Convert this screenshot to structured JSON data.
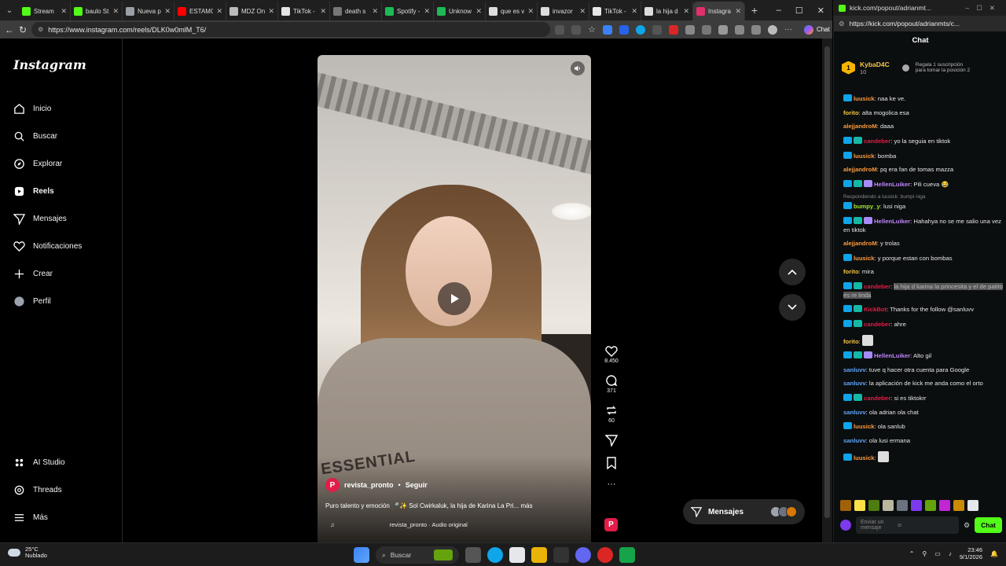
{
  "browser": {
    "tabs": [
      {
        "label": "Stream",
        "color": "#53fc18"
      },
      {
        "label": "baulo St",
        "color": "#53fc18"
      },
      {
        "label": "Nueva p",
        "color": "#9aa0a6"
      },
      {
        "label": "ESTAMO",
        "color": "#ff0000"
      },
      {
        "label": "MDZ On",
        "color": "#bbbbbb"
      },
      {
        "label": "TikTok -",
        "color": "#e6e6e6"
      },
      {
        "label": "death s",
        "color": "#777777"
      },
      {
        "label": "Spotify -",
        "color": "#1db954"
      },
      {
        "label": "Unknow",
        "color": "#1db954"
      },
      {
        "label": "que es v",
        "color": "#dddddd"
      },
      {
        "label": "invazor",
        "color": "#dddddd"
      },
      {
        "label": "TikTok -",
        "color": "#e6e6e6"
      },
      {
        "label": "la hija d",
        "color": "#dddddd"
      },
      {
        "label": "Instagra",
        "color": "#e1306c",
        "active": true
      }
    ],
    "url": "https://www.instagram.com/reels/DLK0w0mlM_T6/",
    "chat_button": "Chat"
  },
  "instagram": {
    "logo": "Instagram",
    "nav": [
      {
        "label": "Inicio",
        "icon": "home-icon"
      },
      {
        "label": "Buscar",
        "icon": "search-icon"
      },
      {
        "label": "Explorar",
        "icon": "compass-icon"
      },
      {
        "label": "Reels",
        "icon": "reels-icon",
        "active": true
      },
      {
        "label": "Mensajes",
        "icon": "send-icon"
      },
      {
        "label": "Notificaciones",
        "icon": "heart-icon"
      },
      {
        "label": "Crear",
        "icon": "plus-icon"
      },
      {
        "label": "Perfil",
        "icon": "avatar-icon"
      }
    ],
    "bottom_nav": [
      {
        "label": "AI Studio",
        "icon": "ai-studio-icon"
      },
      {
        "label": "Threads",
        "icon": "threads-icon"
      },
      {
        "label": "Más",
        "icon": "menu-icon"
      }
    ],
    "reel": {
      "shirt_text": "ESSENTIAL",
      "author": "revista_pronto",
      "author_initial": "P",
      "separator": "•",
      "follow": "Seguir",
      "caption": "Puro talento y emoción 🎤✨ Sol Cwirkaluk, la hija de Karina La Pri... más",
      "audio_author": "revista_pronto",
      "audio_label": "revista_pronto · Audio original",
      "likes": "8.450",
      "comments": "371",
      "reposts": "60"
    },
    "messages_pill": "Mensajes"
  },
  "kick": {
    "window_title": "kick.com/popout/adrianmt...",
    "url": "https://kick.com/popout/adrianmts/c...",
    "header": "Chat",
    "pinned": {
      "name": "KybaD4C",
      "level": "10",
      "rank": "1",
      "gift_text_1": "Regala 1 suscripción",
      "gift_text_2": "para tomar la posición 2"
    },
    "messages": [
      {
        "user": "luusick",
        "color": "#ff9a3c",
        "badges": 1,
        "text": "naa ke ve."
      },
      {
        "user": "forito",
        "color": "#f5c542",
        "badges": 0,
        "text": "alta mogolica esa"
      },
      {
        "user": "alejjandroM",
        "color": "#ff9a3c",
        "badges": 0,
        "text": "daaa"
      },
      {
        "user": "candeber",
        "color": "#e11d48",
        "badges": 2,
        "text": "yo la seguia en tiktok"
      },
      {
        "user": "luusick",
        "color": "#ff9a3c",
        "badges": 1,
        "text": "bomba"
      },
      {
        "user": "alejjandroM",
        "color": "#ff9a3c",
        "badges": 0,
        "text": "pq era fan de tomas mazza"
      },
      {
        "user": "HellenLuiker",
        "color": "#c084fc",
        "badges": 3,
        "text": "Pili cueva 😂"
      },
      {
        "user": "bumpy_y",
        "color": "#a3e635",
        "badges": 1,
        "reply": "Respondiendo a luusick: bumpi niga",
        "text": "lusi niga"
      },
      {
        "user": "HellenLuiker",
        "color": "#c084fc",
        "badges": 3,
        "text": "Hahahya no se me salio una vez en tiktok"
      },
      {
        "user": "alejjandroM",
        "color": "#ff9a3c",
        "badges": 0,
        "text": "y trolas"
      },
      {
        "user": "luusick",
        "color": "#ff9a3c",
        "badges": 1,
        "text": "y porque estan con bombas"
      },
      {
        "user": "forito",
        "color": "#f5c542",
        "badges": 0,
        "text": "mira"
      },
      {
        "user": "candeber",
        "color": "#e11d48",
        "badges": 2,
        "hidden": true,
        "text": "la hija d karina la princesita y el de patito es re linda"
      },
      {
        "user": "KickBot",
        "color": "#e11d48",
        "badges": 2,
        "text": "Thanks for the follow @sanluvv"
      },
      {
        "user": "candeber",
        "color": "#e11d48",
        "badges": 2,
        "text": "ahre"
      },
      {
        "user": "forito",
        "color": "#f5c542",
        "badges": 0,
        "emote": true,
        "text": ""
      },
      {
        "user": "HellenLuiker",
        "color": "#c084fc",
        "badges": 3,
        "text": "Alto gil"
      },
      {
        "user": "sanluvv",
        "color": "#60a5fa",
        "badges": 0,
        "text": "tuve q hacer otra cuenta para Google"
      },
      {
        "user": "sanluvv",
        "color": "#60a5fa",
        "badges": 0,
        "text": "la aplicación de kick me anda como el orto"
      },
      {
        "user": "candeber",
        "color": "#e11d48",
        "badges": 2,
        "text": "si es tiktokrr"
      },
      {
        "user": "sanluvv",
        "color": "#60a5fa",
        "badges": 0,
        "text": "ola adrian ola chat"
      },
      {
        "user": "luusick",
        "color": "#ff9a3c",
        "badges": 1,
        "text": "ola sanlub"
      },
      {
        "user": "sanluvv",
        "color": "#60a5fa",
        "badges": 0,
        "text": "ola lusi ermana"
      },
      {
        "user": "luusick",
        "color": "#ff9a3c",
        "badges": 1,
        "emote": true,
        "text": ""
      }
    ],
    "input_placeholder": "Enviar un mensaje",
    "send_label": "Chat"
  },
  "taskbar": {
    "temp": "25°C",
    "weather": "Nublado",
    "search": "Buscar",
    "time": "23:46",
    "date": "9/1/2026"
  }
}
